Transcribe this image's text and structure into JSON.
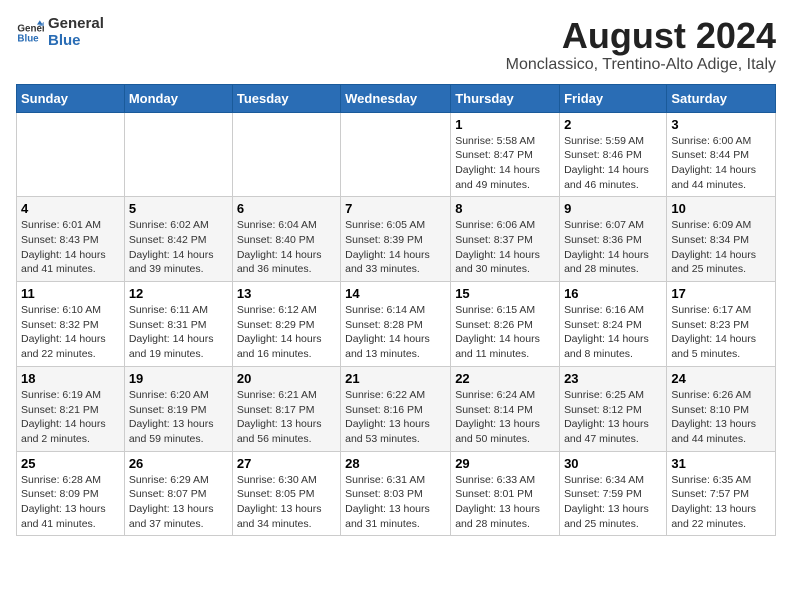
{
  "header": {
    "logo_line1": "General",
    "logo_line2": "Blue",
    "month_year": "August 2024",
    "location": "Monclassico, Trentino-Alto Adige, Italy"
  },
  "weekdays": [
    "Sunday",
    "Monday",
    "Tuesday",
    "Wednesday",
    "Thursday",
    "Friday",
    "Saturday"
  ],
  "weeks": [
    [
      {
        "day": "",
        "info": ""
      },
      {
        "day": "",
        "info": ""
      },
      {
        "day": "",
        "info": ""
      },
      {
        "day": "",
        "info": ""
      },
      {
        "day": "1",
        "info": "Sunrise: 5:58 AM\nSunset: 8:47 PM\nDaylight: 14 hours and 49 minutes."
      },
      {
        "day": "2",
        "info": "Sunrise: 5:59 AM\nSunset: 8:46 PM\nDaylight: 14 hours and 46 minutes."
      },
      {
        "day": "3",
        "info": "Sunrise: 6:00 AM\nSunset: 8:44 PM\nDaylight: 14 hours and 44 minutes."
      }
    ],
    [
      {
        "day": "4",
        "info": "Sunrise: 6:01 AM\nSunset: 8:43 PM\nDaylight: 14 hours and 41 minutes."
      },
      {
        "day": "5",
        "info": "Sunrise: 6:02 AM\nSunset: 8:42 PM\nDaylight: 14 hours and 39 minutes."
      },
      {
        "day": "6",
        "info": "Sunrise: 6:04 AM\nSunset: 8:40 PM\nDaylight: 14 hours and 36 minutes."
      },
      {
        "day": "7",
        "info": "Sunrise: 6:05 AM\nSunset: 8:39 PM\nDaylight: 14 hours and 33 minutes."
      },
      {
        "day": "8",
        "info": "Sunrise: 6:06 AM\nSunset: 8:37 PM\nDaylight: 14 hours and 30 minutes."
      },
      {
        "day": "9",
        "info": "Sunrise: 6:07 AM\nSunset: 8:36 PM\nDaylight: 14 hours and 28 minutes."
      },
      {
        "day": "10",
        "info": "Sunrise: 6:09 AM\nSunset: 8:34 PM\nDaylight: 14 hours and 25 minutes."
      }
    ],
    [
      {
        "day": "11",
        "info": "Sunrise: 6:10 AM\nSunset: 8:32 PM\nDaylight: 14 hours and 22 minutes."
      },
      {
        "day": "12",
        "info": "Sunrise: 6:11 AM\nSunset: 8:31 PM\nDaylight: 14 hours and 19 minutes."
      },
      {
        "day": "13",
        "info": "Sunrise: 6:12 AM\nSunset: 8:29 PM\nDaylight: 14 hours and 16 minutes."
      },
      {
        "day": "14",
        "info": "Sunrise: 6:14 AM\nSunset: 8:28 PM\nDaylight: 14 hours and 13 minutes."
      },
      {
        "day": "15",
        "info": "Sunrise: 6:15 AM\nSunset: 8:26 PM\nDaylight: 14 hours and 11 minutes."
      },
      {
        "day": "16",
        "info": "Sunrise: 6:16 AM\nSunset: 8:24 PM\nDaylight: 14 hours and 8 minutes."
      },
      {
        "day": "17",
        "info": "Sunrise: 6:17 AM\nSunset: 8:23 PM\nDaylight: 14 hours and 5 minutes."
      }
    ],
    [
      {
        "day": "18",
        "info": "Sunrise: 6:19 AM\nSunset: 8:21 PM\nDaylight: 14 hours and 2 minutes."
      },
      {
        "day": "19",
        "info": "Sunrise: 6:20 AM\nSunset: 8:19 PM\nDaylight: 13 hours and 59 minutes."
      },
      {
        "day": "20",
        "info": "Sunrise: 6:21 AM\nSunset: 8:17 PM\nDaylight: 13 hours and 56 minutes."
      },
      {
        "day": "21",
        "info": "Sunrise: 6:22 AM\nSunset: 8:16 PM\nDaylight: 13 hours and 53 minutes."
      },
      {
        "day": "22",
        "info": "Sunrise: 6:24 AM\nSunset: 8:14 PM\nDaylight: 13 hours and 50 minutes."
      },
      {
        "day": "23",
        "info": "Sunrise: 6:25 AM\nSunset: 8:12 PM\nDaylight: 13 hours and 47 minutes."
      },
      {
        "day": "24",
        "info": "Sunrise: 6:26 AM\nSunset: 8:10 PM\nDaylight: 13 hours and 44 minutes."
      }
    ],
    [
      {
        "day": "25",
        "info": "Sunrise: 6:28 AM\nSunset: 8:09 PM\nDaylight: 13 hours and 41 minutes."
      },
      {
        "day": "26",
        "info": "Sunrise: 6:29 AM\nSunset: 8:07 PM\nDaylight: 13 hours and 37 minutes."
      },
      {
        "day": "27",
        "info": "Sunrise: 6:30 AM\nSunset: 8:05 PM\nDaylight: 13 hours and 34 minutes."
      },
      {
        "day": "28",
        "info": "Sunrise: 6:31 AM\nSunset: 8:03 PM\nDaylight: 13 hours and 31 minutes."
      },
      {
        "day": "29",
        "info": "Sunrise: 6:33 AM\nSunset: 8:01 PM\nDaylight: 13 hours and 28 minutes."
      },
      {
        "day": "30",
        "info": "Sunrise: 6:34 AM\nSunset: 7:59 PM\nDaylight: 13 hours and 25 minutes."
      },
      {
        "day": "31",
        "info": "Sunrise: 6:35 AM\nSunset: 7:57 PM\nDaylight: 13 hours and 22 minutes."
      }
    ]
  ]
}
